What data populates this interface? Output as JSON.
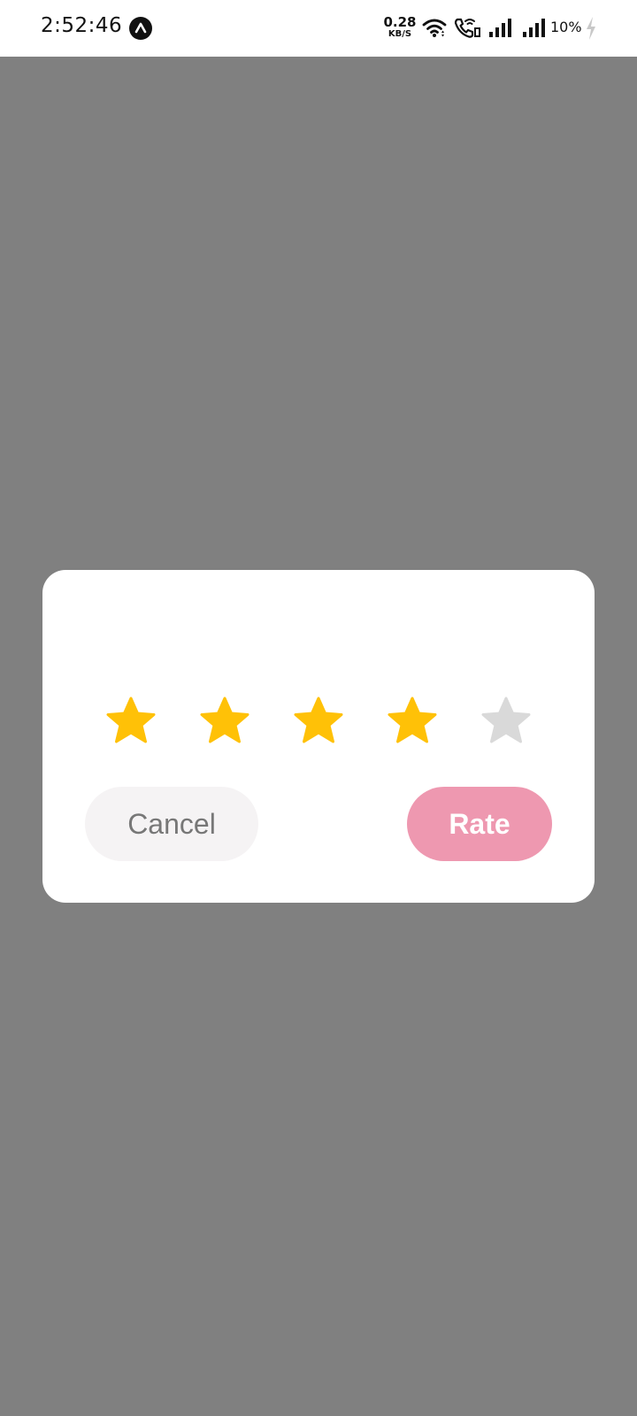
{
  "status_bar": {
    "time": "2:52:46",
    "net_speed_value": "0.28",
    "net_speed_unit": "KB/S",
    "battery": "10%",
    "icons": [
      "app-badge-icon",
      "wifi-icon",
      "wifi-calling-icon",
      "signal-1-icon",
      "signal-2-icon",
      "charging-icon"
    ]
  },
  "dialog": {
    "rating": {
      "value": 4,
      "max": 5,
      "filled_color": "#FFC107",
      "empty_color": "#D9D9D9",
      "icon": "star-icon"
    },
    "cancel_label": "Cancel",
    "rate_label": "Rate"
  },
  "colors": {
    "overlay": "#808080",
    "rate_button": "#EE98B0",
    "cancel_button": "#F5F3F4"
  }
}
